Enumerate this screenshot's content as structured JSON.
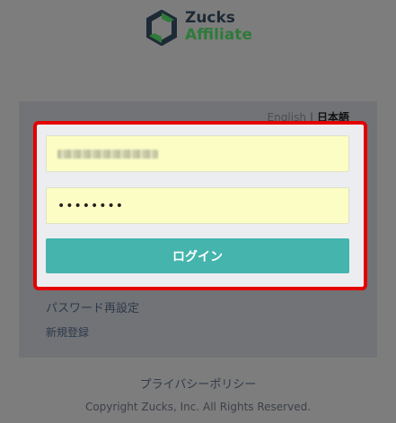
{
  "brand": {
    "line1": "Zucks",
    "line2": "Affiliate",
    "colors": {
      "dark": "#1d2a36",
      "green": "#2f7a3a"
    }
  },
  "language": {
    "english": "English",
    "separator": "|",
    "japanese": "日本語",
    "selected": "日本語"
  },
  "form": {
    "email_value": "",
    "email_obscured": true,
    "password_value": "••••••••",
    "login_label": "ログイン",
    "highlight_color": "#e30000",
    "button_color": "#44b4ad"
  },
  "links": {
    "reset_password": "パスワード再設定",
    "register": "新規登録"
  },
  "footer": {
    "privacy": "プライバシーポリシー",
    "copyright": "Copyright Zucks, Inc. All Rights Reserved."
  }
}
